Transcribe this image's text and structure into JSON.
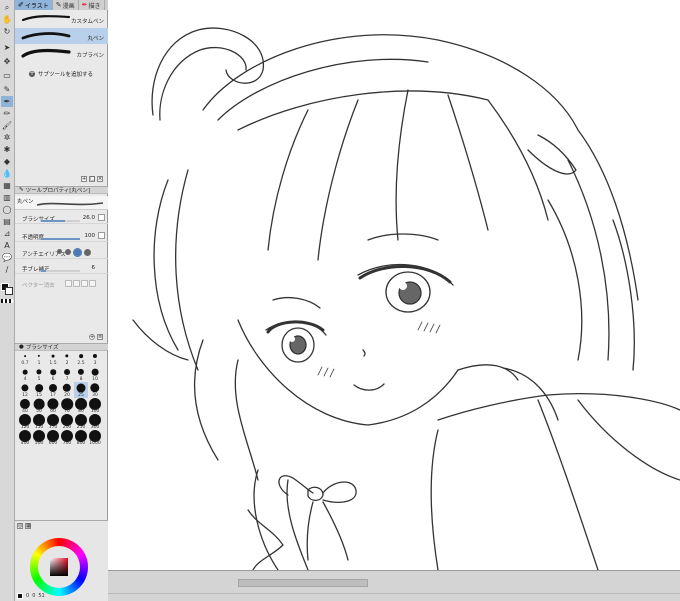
{
  "tabs": [
    {
      "label": "イラスト",
      "icon": "brush-icon",
      "active": true
    },
    {
      "label": "漫画",
      "icon": "pen-icon",
      "active": false
    },
    {
      "label": "描き",
      "icon": "marker-icon",
      "active": false
    }
  ],
  "subtools": [
    {
      "label": "カスタムペン"
    },
    {
      "label": "丸ペン"
    },
    {
      "label": "カブラペン"
    }
  ],
  "add_subtool_label": "サブツールを追加する",
  "toolprop": {
    "header": "ツールプロパティ[丸ペン]",
    "preview_name": "丸ペン",
    "brush_size_label": "ブラシサイズ",
    "brush_size_value": "26.0",
    "opacity_label": "不透明度",
    "opacity_value": "100",
    "antialias_label": "アンチエイリアス",
    "stabilization_label": "手ブレ補正",
    "stabilization_value": "6",
    "vector_label": "ベクター消去"
  },
  "brushsize_header": "ブラシサイズ",
  "brush_sizes": [
    "0.7",
    "1",
    "1.5",
    "2",
    "2.5",
    "3",
    "4",
    "5",
    "6",
    "7",
    "8",
    "10",
    "12",
    "15",
    "17",
    "20",
    "25",
    "30",
    "40",
    "50",
    "60",
    "70",
    "80",
    "100",
    "120",
    "150",
    "170",
    "200",
    "250",
    "300",
    "400",
    "500",
    "600",
    "700",
    "800",
    "1000"
  ],
  "status": {
    "left": "0",
    "mid": "0",
    "right": "51"
  }
}
